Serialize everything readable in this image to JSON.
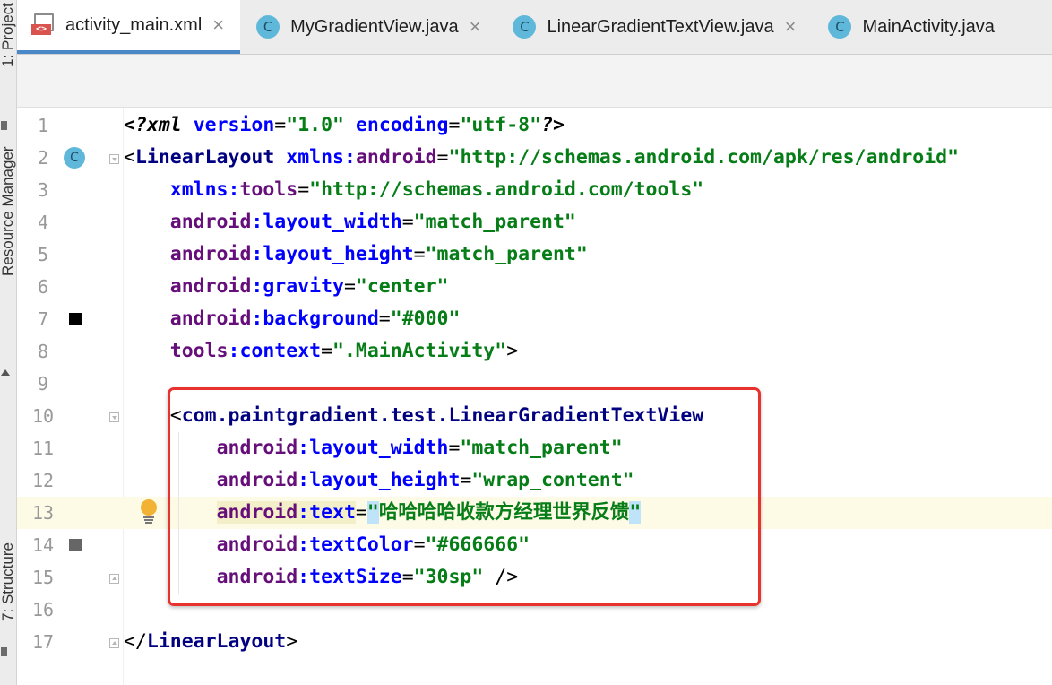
{
  "sidebar": {
    "project_label": "1: Project",
    "resource_manager_label": "Resource Manager",
    "structure_label": "7: Structure"
  },
  "tabs": [
    {
      "label": "activity_main.xml",
      "icon": "xml-file-icon",
      "active": true
    },
    {
      "label": "MyGradientView.java",
      "icon": "class-icon",
      "active": false
    },
    {
      "label": "LinearGradientTextView.java",
      "icon": "class-icon",
      "active": false
    },
    {
      "label": "MainActivity.java",
      "icon": "class-icon",
      "active": false
    }
  ],
  "editor": {
    "line_numbers": [
      "1",
      "2",
      "3",
      "4",
      "5",
      "6",
      "7",
      "8",
      "9",
      "10",
      "11",
      "12",
      "13",
      "14",
      "15",
      "16",
      "17"
    ],
    "current_line": 13,
    "gutter": {
      "class_marker_text": "C",
      "background_swatch_color": "#000000",
      "text_color_swatch_color": "#666666"
    },
    "highlight_box_color": "#e8322e",
    "tokens": {
      "pi_open": "<?",
      "xml_kw": "xml",
      "version_attr": "version",
      "version_val": "\"1.0\"",
      "encoding_attr": "encoding",
      "encoding_val": "\"utf-8\"",
      "pi_close": "?>",
      "lt": "<",
      "gt": ">",
      "eq": "=",
      "self_close": " />",
      "close_open": "</",
      "linear_layout": "LinearLayout",
      "xmlns": "xmlns",
      "colon": ":",
      "android": "android",
      "tools": "tools",
      "xmlns_android_val": "\"http://schemas.android.com/apk/res/android\"",
      "xmlns_tools_val": "\"http://schemas.android.com/tools\"",
      "layout_width": "layout_width",
      "layout_height": "layout_height",
      "gravity": "gravity",
      "background": "background",
      "context": "context",
      "text": "text",
      "textColor": "textColor",
      "textSize": "textSize",
      "match_parent_val": "\"match_parent\"",
      "wrap_content_val": "\"wrap_content\"",
      "center_val": "\"center\"",
      "bg_val": "\"#000\"",
      "context_val": "\".MainActivity\"",
      "custom_view": "com.paintgradient.test.LinearGradientTextView",
      "quote": "\"",
      "text_content": "哈哈哈哈收款方经理世界反馈",
      "text_color_val": "\"#666666\"",
      "text_size_val": "\"30sp\""
    }
  }
}
